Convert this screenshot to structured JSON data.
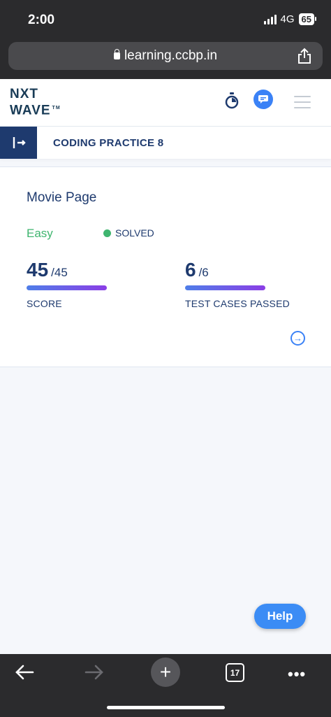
{
  "status_bar": {
    "time": "2:00",
    "network": "4G",
    "battery": "65"
  },
  "browser": {
    "url": "learning.ccbp.in",
    "tab_count": "17"
  },
  "header": {
    "logo_line1": "NXT",
    "logo_line2": "WAVE",
    "logo_tm": "TM"
  },
  "practice": {
    "title": "CODING PRACTICE 8"
  },
  "question": {
    "title": "Movie Page",
    "difficulty": "Easy",
    "status": "SOLVED",
    "score": {
      "value": "45",
      "total": "/45",
      "label": "SCORE"
    },
    "tests": {
      "value": "6",
      "total": "/6",
      "label": "TEST CASES PASSED"
    }
  },
  "help_label": "Help",
  "colors": {
    "primary": "#1e3a6e",
    "accent": "#3b82f6",
    "success": "#3fb56f"
  }
}
